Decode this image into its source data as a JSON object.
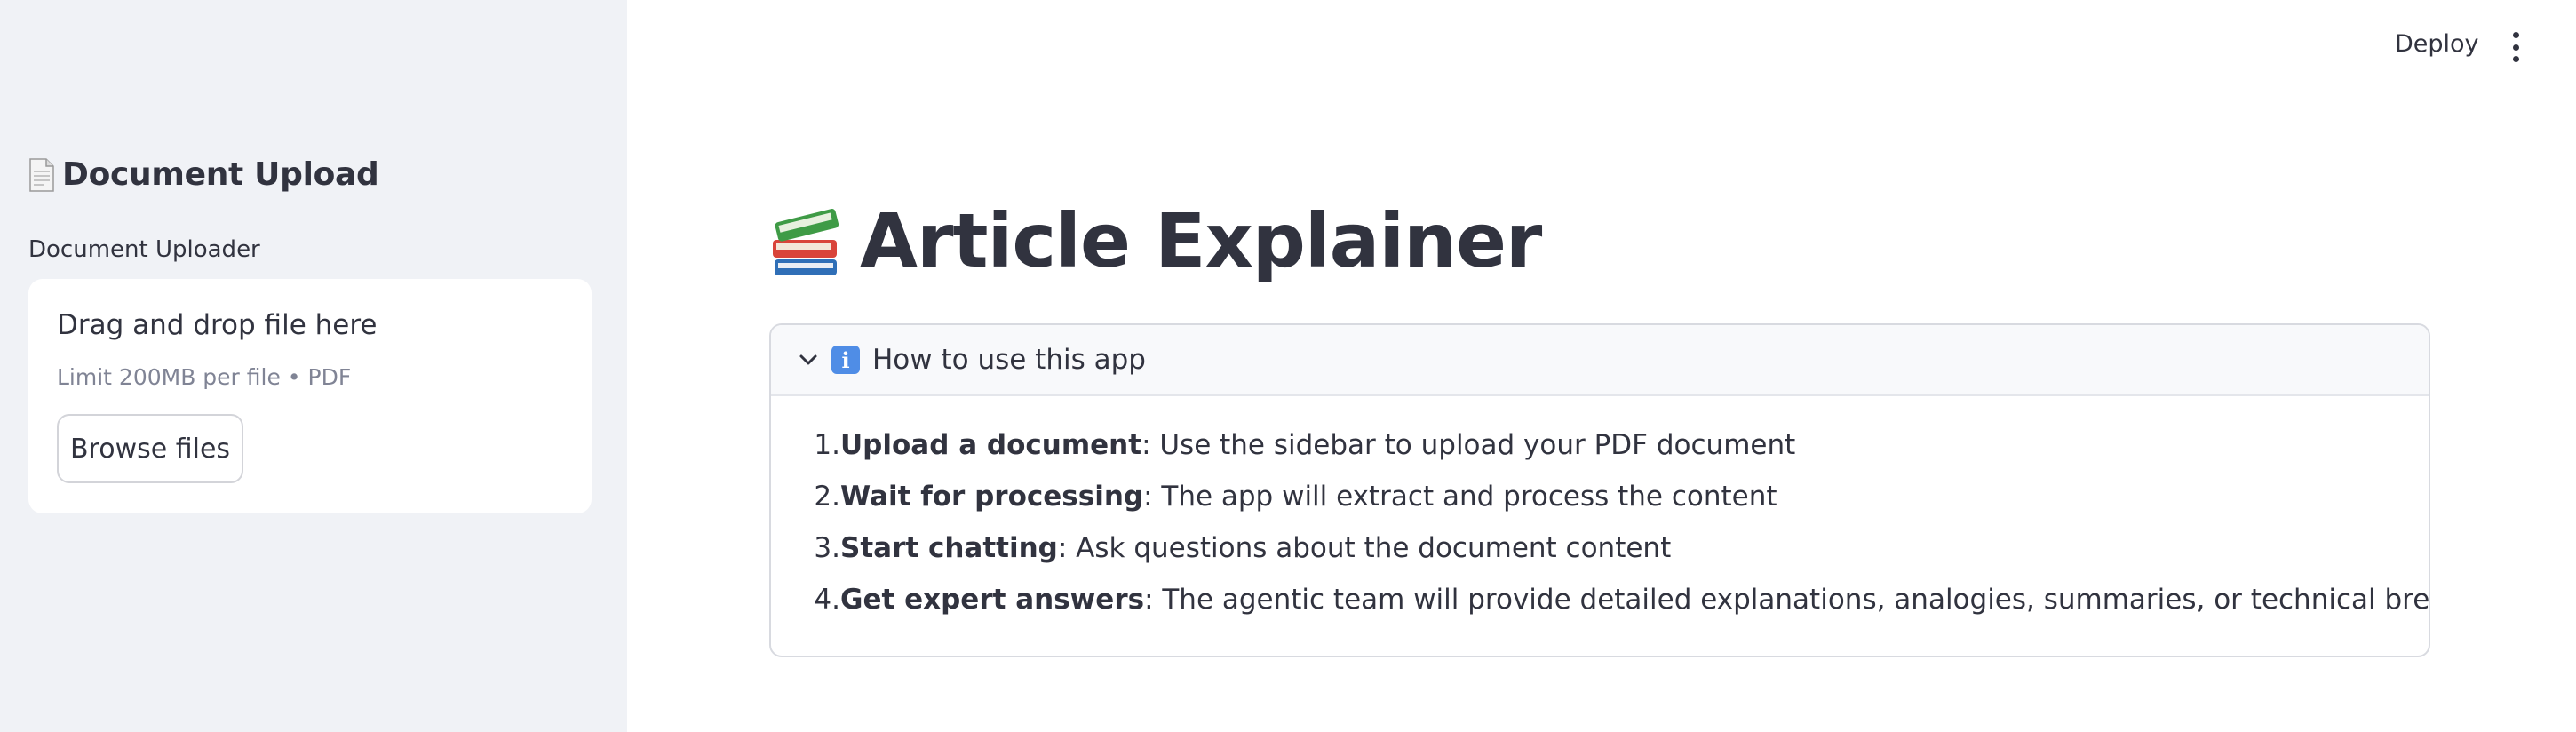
{
  "header": {
    "deploy_label": "Deploy",
    "menu_icon": "kebab-menu-icon"
  },
  "sidebar": {
    "title": "Document Upload",
    "title_icon": "document-icon",
    "uploader_label": "Document Uploader",
    "dropzone": {
      "title": "Drag and drop file here",
      "limit": "Limit 200MB per file • PDF",
      "browse_label": "Browse files"
    }
  },
  "main": {
    "title": "Article Explainer",
    "title_icon": "books-icon",
    "expander": {
      "title": "How to use this app",
      "icon": "info-icon",
      "toggle_icon": "chevron-down-icon",
      "steps": [
        {
          "num": "1.",
          "bold": "Upload a document",
          "text": ": Use the sidebar to upload your PDF document"
        },
        {
          "num": "2.",
          "bold": "Wait for processing",
          "text": ": The app will extract and process the content"
        },
        {
          "num": "3.",
          "bold": "Start chatting",
          "text": ": Ask questions about the document content"
        },
        {
          "num": "4.",
          "bold": "Get expert answers",
          "text": ": The agentic team will provide detailed explanations, analogies, summaries, or technical breakdowns"
        }
      ]
    }
  },
  "colors": {
    "sidebar_bg": "#f0f2f6",
    "text": "#31333f",
    "muted": "#808495",
    "border": "#d8dae0"
  }
}
